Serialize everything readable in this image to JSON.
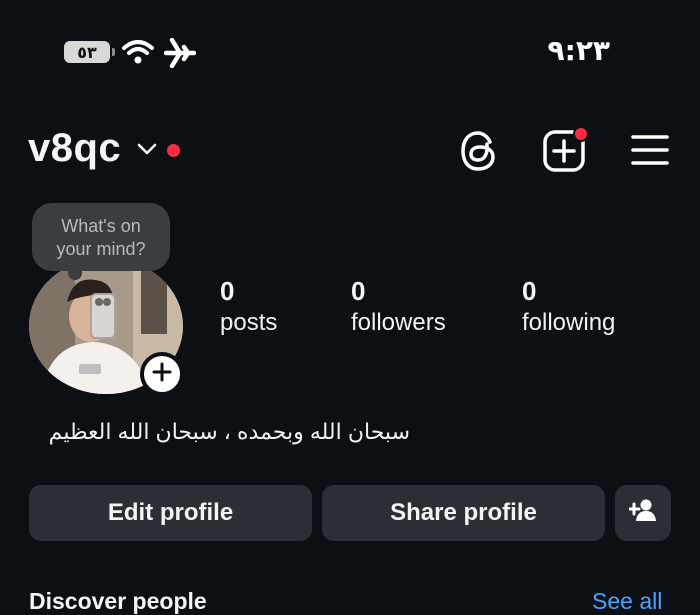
{
  "status_bar": {
    "battery": "٥٣",
    "time": "٩:٢٣"
  },
  "header": {
    "username": "v8qc"
  },
  "note": {
    "line1": "What's on",
    "line2": "your mind?"
  },
  "stats": [
    {
      "value": "0",
      "label": "posts"
    },
    {
      "value": "0",
      "label": "followers"
    },
    {
      "value": "0",
      "label": "following"
    }
  ],
  "bio": "سبحان الله وبحمده ، سبحان الله العظيم",
  "buttons": {
    "edit_profile": "Edit profile",
    "share_profile": "Share profile"
  },
  "discover": {
    "title": "Discover people",
    "see_all": "See all"
  },
  "colors": {
    "background": "#0c0f14",
    "button_bg": "#2b2f35",
    "notification": "#ff2a3d",
    "link": "#4aa3ff"
  }
}
